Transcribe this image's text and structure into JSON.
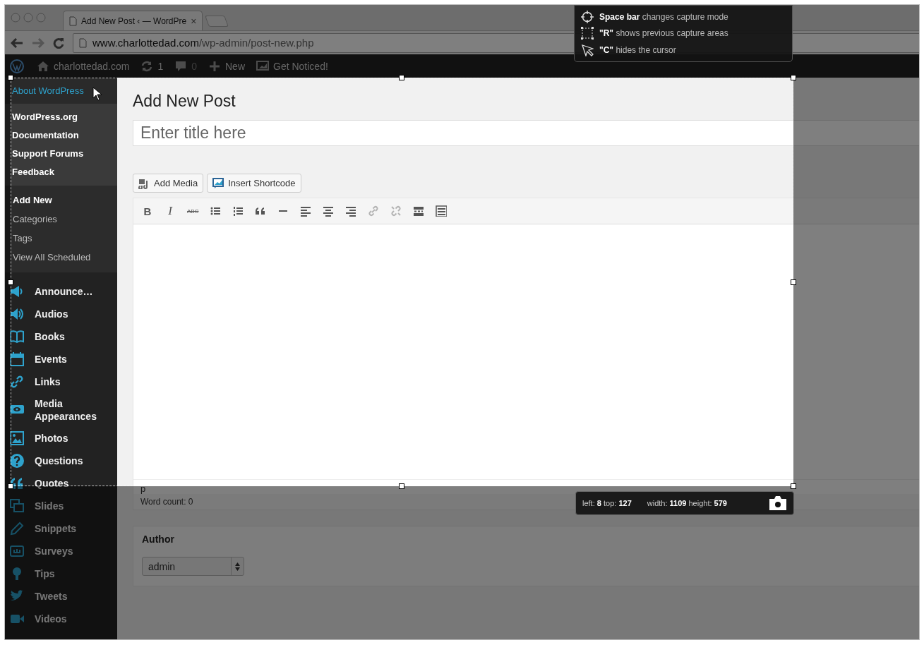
{
  "browser": {
    "tab": {
      "title": "Add New Post ‹ — WordPre",
      "close": "×"
    },
    "url": {
      "domain": "www.charlottedad.com",
      "path": "/wp-admin/post-new.php"
    }
  },
  "admin_bar": {
    "site": "charlottedad.com",
    "updates": "1",
    "comments": "0",
    "new": "New",
    "custom": "Get Noticed!"
  },
  "help_flyout": {
    "title": "About WordPress",
    "items": [
      "WordPress.org",
      "Documentation",
      "Support Forums",
      "Feedback"
    ]
  },
  "submenu": [
    {
      "label": "Add New",
      "selected": true
    },
    {
      "label": "Categories",
      "selected": false
    },
    {
      "label": "Tags",
      "selected": false
    },
    {
      "label": "View All Scheduled",
      "selected": false
    }
  ],
  "menu": [
    {
      "label": "Announce…",
      "kind": "megaphone"
    },
    {
      "label": "Audios",
      "kind": "speaker"
    },
    {
      "label": "Books",
      "kind": "book"
    },
    {
      "label": "Events",
      "kind": "calendar"
    },
    {
      "label": "Links",
      "kind": "link"
    },
    {
      "label": "Media Appearances",
      "kind": "eye"
    },
    {
      "label": "Photos",
      "kind": "photo"
    },
    {
      "label": "Questions",
      "kind": "question"
    },
    {
      "label": "Quotes",
      "kind": "quote"
    },
    {
      "label": "Slides",
      "kind": "slides"
    },
    {
      "label": "Snippets",
      "kind": "pencil"
    },
    {
      "label": "Surveys",
      "kind": "survey"
    },
    {
      "label": "Tips",
      "kind": "pin"
    },
    {
      "label": "Tweets",
      "kind": "bird"
    },
    {
      "label": "Videos",
      "kind": "video"
    }
  ],
  "post": {
    "heading": "Add New Post",
    "title_placeholder": "Enter title here",
    "buttons": [
      {
        "label": "Add Media",
        "kind": "media"
      },
      {
        "label": "Insert Shortcode",
        "kind": "shortcode"
      }
    ],
    "toolbar": [
      {
        "kind": "bold",
        "label": "B",
        "disabled": false
      },
      {
        "kind": "italic",
        "label": "I",
        "disabled": false
      },
      {
        "kind": "strike",
        "label": "ABC",
        "disabled": false
      },
      {
        "kind": "ul",
        "disabled": false
      },
      {
        "kind": "ol",
        "disabled": false
      },
      {
        "kind": "quote",
        "disabled": false
      },
      {
        "kind": "hr",
        "disabled": false
      },
      {
        "kind": "alignleft",
        "disabled": false
      },
      {
        "kind": "aligncenter",
        "disabled": false
      },
      {
        "kind": "alignright",
        "disabled": false
      },
      {
        "kind": "link",
        "disabled": true
      },
      {
        "kind": "unlink",
        "disabled": true
      },
      {
        "kind": "more",
        "disabled": false
      },
      {
        "kind": "kitchensink",
        "disabled": false
      }
    ],
    "path": "p",
    "word_count": "Word count: 0"
  },
  "author": {
    "heading": "Author",
    "value": "admin"
  },
  "capture_tips": [
    {
      "kind": "crosshair",
      "text": "**Space bar** changes capture mode"
    },
    {
      "kind": "frame",
      "text": "**\"R\"** shows previous capture areas"
    },
    {
      "kind": "cursor",
      "text": "**\"C\"** hides the cursor"
    }
  ],
  "capture_info": {
    "position": "left: **8** top: **127**",
    "size": "width: **1109** height: **579**"
  }
}
